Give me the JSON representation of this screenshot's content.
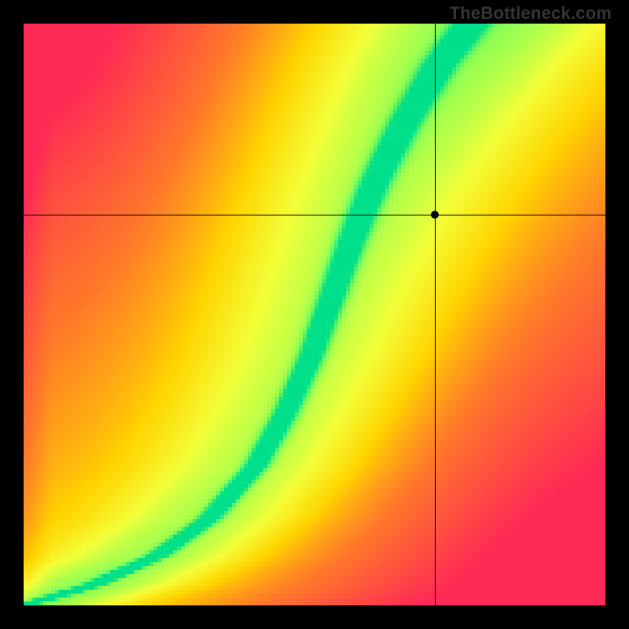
{
  "watermark": "TheBottleneck.com",
  "chart_data": {
    "type": "heatmap",
    "title": "",
    "xlabel": "",
    "ylabel": "",
    "xlim": [
      0,
      1
    ],
    "ylim": [
      0,
      1
    ],
    "grid_n": 148,
    "colorscale": [
      {
        "t": 0.0,
        "hex": "#ff2a55"
      },
      {
        "t": 0.25,
        "hex": "#ff7a2a"
      },
      {
        "t": 0.45,
        "hex": "#ffd400"
      },
      {
        "t": 0.62,
        "hex": "#f4ff3a"
      },
      {
        "t": 0.8,
        "hex": "#8cff55"
      },
      {
        "t": 1.0,
        "hex": "#00e08a"
      }
    ],
    "ridge_points": [
      {
        "x": 0.0,
        "y": 0.0
      },
      {
        "x": 0.12,
        "y": 0.035
      },
      {
        "x": 0.23,
        "y": 0.085
      },
      {
        "x": 0.32,
        "y": 0.15
      },
      {
        "x": 0.4,
        "y": 0.24
      },
      {
        "x": 0.45,
        "y": 0.33
      },
      {
        "x": 0.495,
        "y": 0.43
      },
      {
        "x": 0.53,
        "y": 0.53
      },
      {
        "x": 0.565,
        "y": 0.63
      },
      {
        "x": 0.605,
        "y": 0.73
      },
      {
        "x": 0.655,
        "y": 0.83
      },
      {
        "x": 0.715,
        "y": 0.93
      },
      {
        "x": 0.77,
        "y": 1.0
      }
    ],
    "ridge_width_base": 0.045,
    "ridge_width_top": 0.075,
    "corner_falloff": {
      "top_left": {
        "cx": 0.0,
        "cy": 1.0,
        "radius": 0.9
      },
      "bottom_right": {
        "cx": 1.0,
        "cy": 0.0,
        "radius": 1.3
      }
    },
    "crosshair": {
      "x": 0.707,
      "y": 0.672
    },
    "marker": {
      "x": 0.707,
      "y": 0.672
    }
  }
}
